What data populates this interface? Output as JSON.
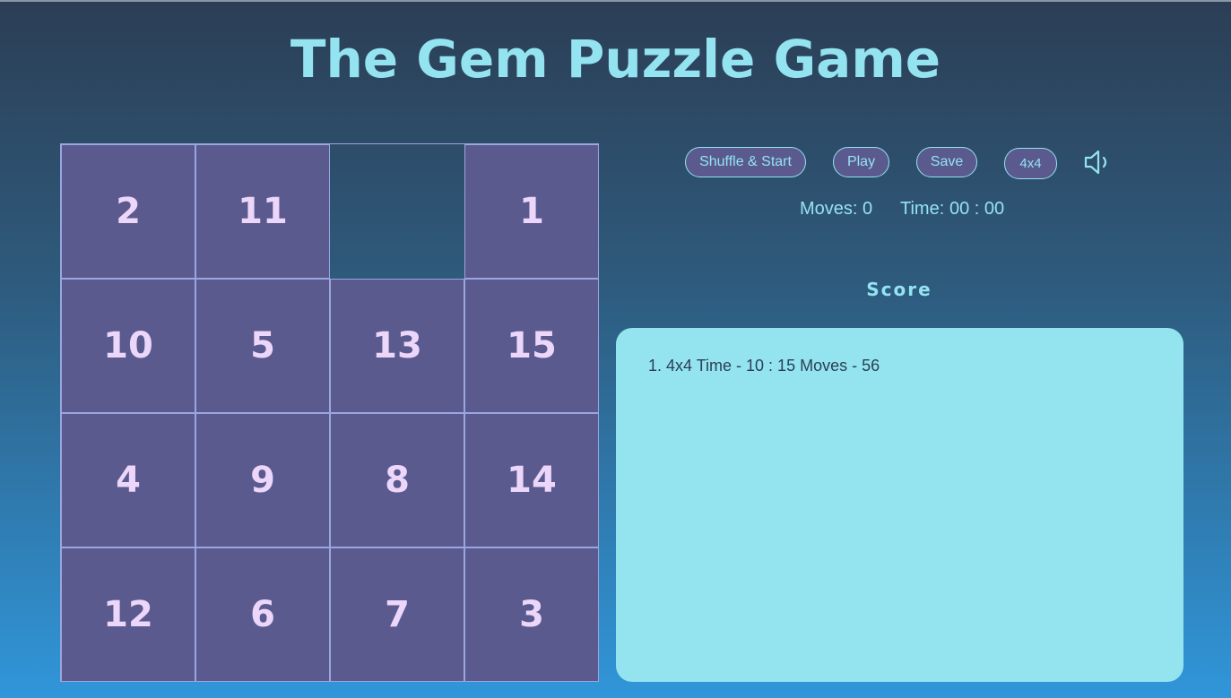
{
  "title": "The Gem Puzzle Game",
  "board": {
    "size": "4x4",
    "tiles": [
      "2",
      "11",
      "",
      "1",
      "10",
      "5",
      "13",
      "15",
      "4",
      "9",
      "8",
      "14",
      "12",
      "6",
      "7",
      "3"
    ]
  },
  "controls": {
    "shuffle_label": "Shuffle & Start",
    "play_label": "Play",
    "save_label": "Save",
    "size_label": "4x4",
    "sound_icon": "speaker-icon"
  },
  "stats": {
    "moves_label": "Moves:",
    "moves_value": "0",
    "time_label": "Time:",
    "time_value": "00 : 00"
  },
  "score": {
    "title": "Score",
    "entries": [
      "1. 4x4 Time - 10 : 15 Moves - 56"
    ]
  },
  "colors": {
    "accent": "#94e3f0",
    "tile": "#5a5a8e",
    "tile_text": "#ecd7fb",
    "panel": "#93e4ef"
  }
}
